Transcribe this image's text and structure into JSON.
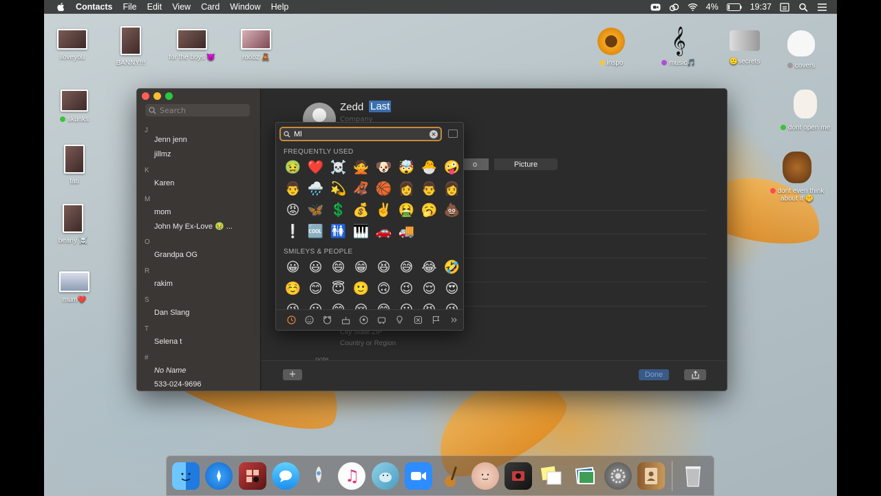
{
  "menubar": {
    "app": "Contacts",
    "menus": [
      "File",
      "Edit",
      "View",
      "Card",
      "Window",
      "Help"
    ],
    "battery": "4%",
    "clock": "19:37"
  },
  "desktop_icons": [
    {
      "label": "iloveyou"
    },
    {
      "label": "BANNY!!!"
    },
    {
      "label": "for the boys 😈"
    },
    {
      "label": "roobz 🧸"
    },
    {
      "label": "inspo"
    },
    {
      "label": "music🎵"
    },
    {
      "label": "🙁secrets"
    },
    {
      "label": "covers"
    },
    {
      "label": "skunks"
    },
    {
      "label": "tati"
    },
    {
      "label": "beany ☠️"
    },
    {
      "label": "mum❤️"
    },
    {
      "label": "dont open me"
    },
    {
      "label": "dont even think about it 🤫"
    }
  ],
  "sidebar": {
    "search_placeholder": "Search",
    "sections": [
      {
        "letter": "J",
        "contacts": [
          "Jenn jenn",
          "jillmz"
        ]
      },
      {
        "letter": "K",
        "contacts": [
          "Karen"
        ]
      },
      {
        "letter": "M",
        "contacts": [
          "mom",
          "John My Ex-Love 🤢 ..."
        ]
      },
      {
        "letter": "O",
        "contacts": [
          "Grandpa OG"
        ]
      },
      {
        "letter": "R",
        "contacts": [
          "rakim"
        ]
      },
      {
        "letter": "S",
        "contacts": [
          "Dan Slang"
        ]
      },
      {
        "letter": "T",
        "contacts": [
          "Selena t"
        ]
      },
      {
        "letter": "#",
        "contacts": [
          "No Name",
          "533-024-9696"
        ]
      }
    ]
  },
  "card": {
    "first_name": "Zedd",
    "last_name": "Last",
    "company_placeholder": "Company",
    "segment_left": "o",
    "segment_right": "Picture",
    "address_line": "City State ZIP",
    "country_placeholder": "Country or Region",
    "note_label": "note",
    "add_label": "+",
    "done_label": "Done"
  },
  "emoji_picker": {
    "query": "Ml",
    "sections": [
      {
        "title": "FREQUENTLY USED",
        "rows": [
          [
            "🤢",
            "❤️",
            "☠️",
            "🙅",
            "🐶",
            "🤯",
            "🐣",
            "🤪"
          ],
          [
            "👨",
            "🌧️",
            "💫",
            "🦧",
            "🏀",
            "👩",
            "👨",
            "👩"
          ],
          [
            "😡",
            "🦋",
            "💲",
            "💰",
            "✌️",
            "🤮",
            "🥱",
            "💩"
          ],
          [
            "❕",
            "🆒",
            "🚻",
            "🎹",
            "🚗",
            "🚚"
          ]
        ]
      },
      {
        "title": "SMILEYS & PEOPLE",
        "rows": [
          [
            "😀",
            "😃",
            "😄",
            "😁",
            "😆",
            "😅",
            "😂",
            "🤣"
          ],
          [
            "☺️",
            "😊",
            "😇",
            "🙂",
            "🙃",
            "😉",
            "😌",
            "😍"
          ],
          [
            "😘",
            "😗",
            "😙",
            "😚",
            "😋",
            "😛",
            "😝",
            "😜"
          ]
        ]
      }
    ],
    "category_tabs": [
      "recent",
      "smileys",
      "animals",
      "food",
      "activity",
      "travel",
      "objects",
      "symbols",
      "flags",
      "more"
    ]
  },
  "dock": {
    "apps": [
      "Finder",
      "Safari",
      "Photo Booth",
      "Messages",
      "Launchpad",
      "iTunes",
      "Seal",
      "Zoom",
      "GarageBand",
      "Face",
      "Photo Booth 2",
      "Stickies",
      "Preview",
      "System Preferences",
      "Contacts",
      "Trash"
    ]
  }
}
